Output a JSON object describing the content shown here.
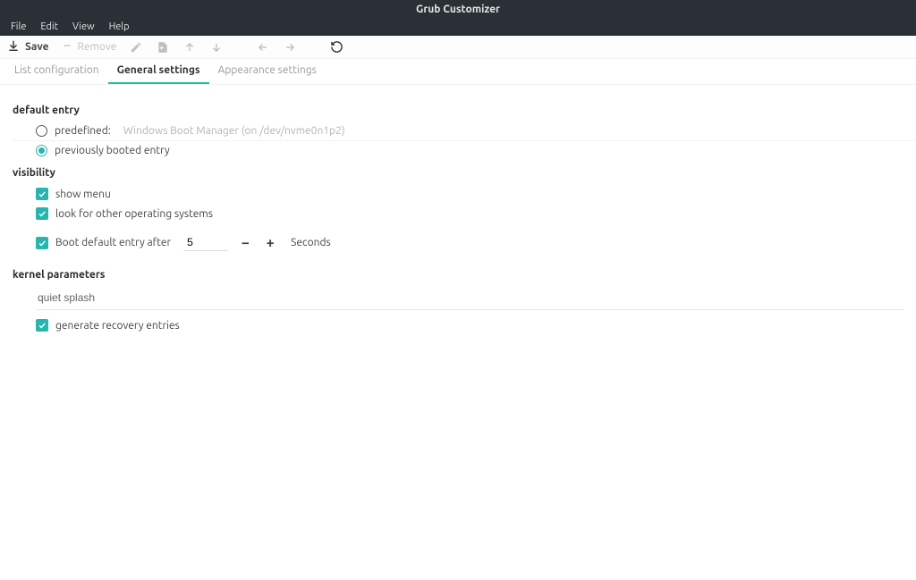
{
  "window": {
    "title": "Grub Customizer"
  },
  "menubar": [
    "File",
    "Edit",
    "View",
    "Help"
  ],
  "toolbar": {
    "save_label": "Save",
    "remove_label": "Remove"
  },
  "tabs": [
    {
      "label": "List configuration",
      "active": false
    },
    {
      "label": "General settings",
      "active": true
    },
    {
      "label": "Appearance settings",
      "active": false
    }
  ],
  "sections": {
    "default_entry": {
      "title": "default entry",
      "predefined_label": "predefined:",
      "predefined_value": "Windows Boot Manager (on /dev/nvme0n1p2)",
      "previously_label": "previously booted entry",
      "selected": "previously"
    },
    "visibility": {
      "title": "visibility",
      "show_menu_label": "show menu",
      "look_other_os_label": "look for other operating systems",
      "boot_default_label": "Boot default entry after",
      "timeout_value": "5",
      "seconds_label": "Seconds"
    },
    "kernel": {
      "title": "kernel parameters",
      "value": "quiet splash",
      "recovery_label": "generate recovery entries"
    }
  }
}
